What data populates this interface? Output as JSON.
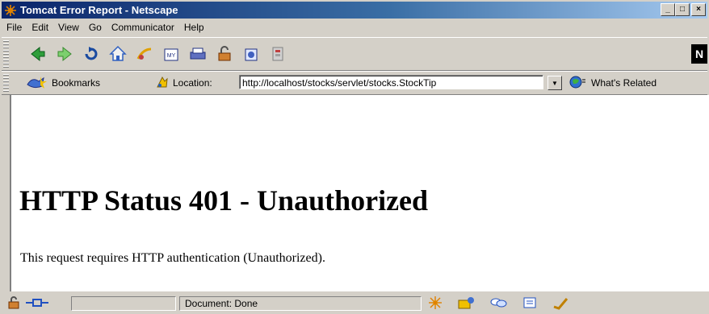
{
  "window": {
    "title": "Tomcat Error Report - Netscape",
    "controls": {
      "minimize": "_",
      "maximize": "□",
      "close": "×"
    }
  },
  "menu": {
    "items": [
      "File",
      "Edit",
      "View",
      "Go",
      "Communicator",
      "Help"
    ]
  },
  "nav_toolbar": {
    "icons": [
      "back-icon",
      "forward-icon",
      "reload-icon",
      "home-icon",
      "search-icon",
      "my-netscape-icon",
      "print-icon",
      "security-icon",
      "shop-icon",
      "stop-icon"
    ],
    "logo": "N"
  },
  "location_toolbar": {
    "bookmarks_label": "Bookmarks",
    "location_label": "Location:",
    "url": "http://localhost/stocks/servlet/stocks.StockTip",
    "related_label": "What's Related"
  },
  "page": {
    "heading": "HTTP Status 401 - Unauthorized",
    "message": "This request requires HTTP authentication (Unauthorized)."
  },
  "status_bar": {
    "status_text": "Document: Done",
    "component_icons": [
      "navigator-icon",
      "mail-icon",
      "discussions-icon",
      "composer-icon",
      "signed-icon"
    ]
  },
  "colors": {
    "title_start": "#0a246a",
    "title_end": "#a6caf0",
    "chrome": "#d4d0c8",
    "content_bg": "#ffffff"
  }
}
